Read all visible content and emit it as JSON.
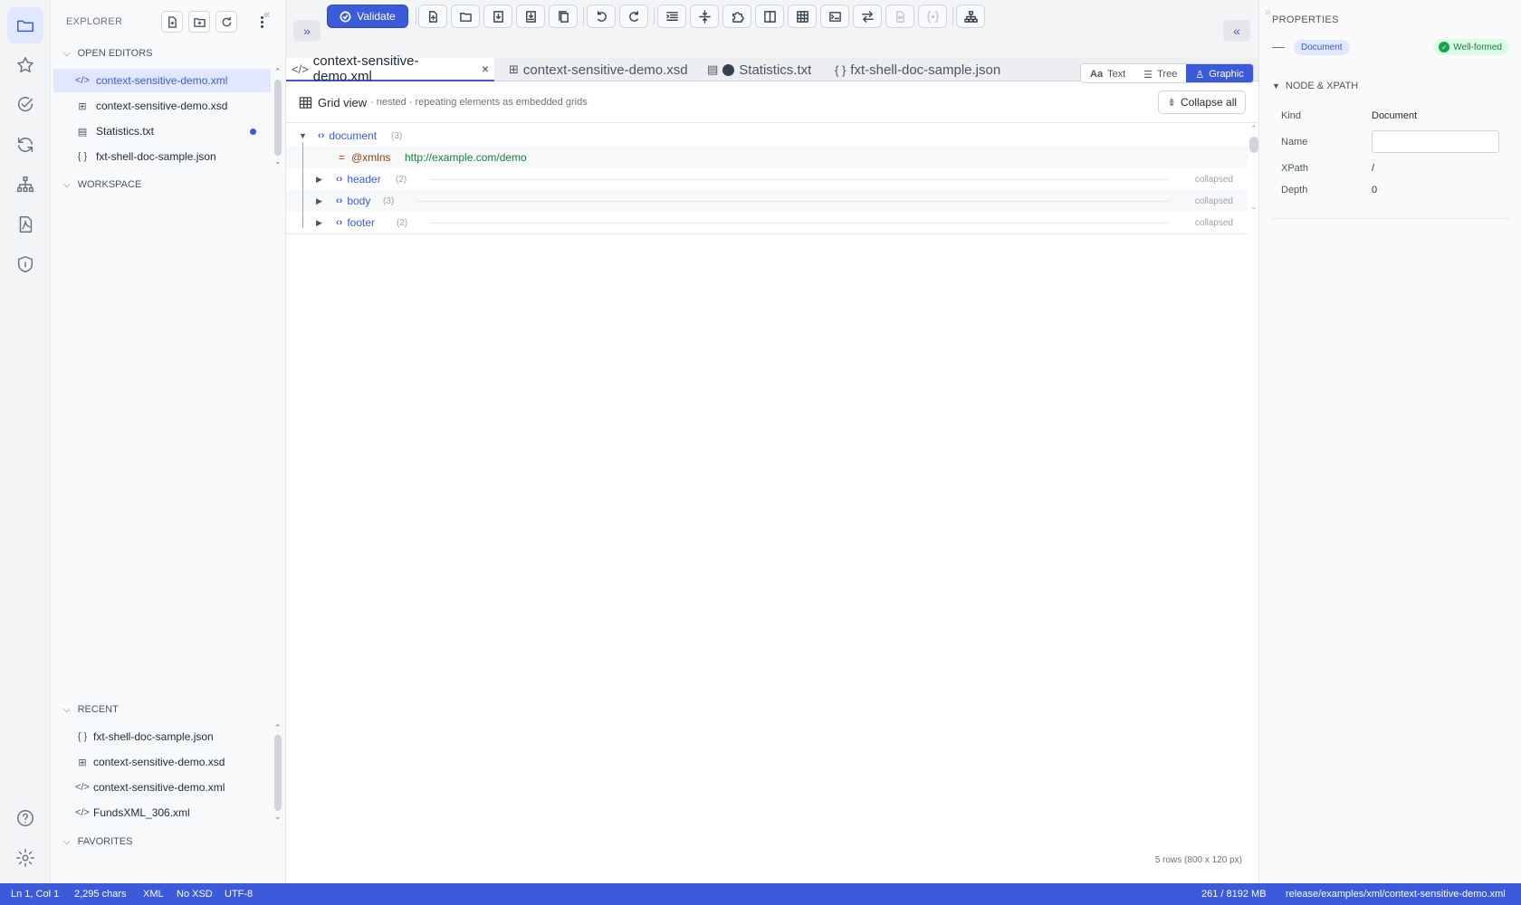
{
  "explorer": {
    "title": "EXPLORER",
    "open_editors": "OPEN EDITORS",
    "workspace": "WORKSPACE",
    "recent": "RECENT",
    "favorites": "FAVORITES",
    "open_files": [
      {
        "label": "context-sensitive-demo.xml",
        "icon": "xml-icon"
      },
      {
        "label": "context-sensitive-demo.xsd",
        "icon": "schema-icon"
      },
      {
        "label": "Statistics.txt",
        "icon": "text-file-icon"
      },
      {
        "label": "fxt-shell-doc-sample.json",
        "icon": "json-icon"
      }
    ],
    "recent_files": [
      {
        "label": "fxt-shell-doc-sample.json",
        "icon": "json-icon"
      },
      {
        "label": "context-sensitive-demo.xsd",
        "icon": "schema-icon"
      },
      {
        "label": "context-sensitive-demo.xml",
        "icon": "xml-icon"
      },
      {
        "label": "FundsXML_306.xml",
        "icon": "xml-icon"
      }
    ]
  },
  "toolbar": {
    "validate_label": "Validate"
  },
  "tabs": [
    {
      "label": "context-sensitive-demo.xml",
      "active": true
    },
    {
      "label": "context-sensitive-demo.xsd"
    },
    {
      "label": "Statistics.txt"
    },
    {
      "label": "fxt-shell-doc-sample.json"
    }
  ],
  "view_modes": {
    "text": "Text",
    "tree": "Tree",
    "graphic": "Graphic"
  },
  "grid_view": {
    "title": "Grid view",
    "subtitle": "· nested · repeating elements as embedded grids",
    "collapse_all": "Collapse all",
    "rows": {
      "document": {
        "name": "document",
        "count": "(3)"
      },
      "attr": {
        "eq": "=",
        "name": "@xmlns",
        "value": "http://example.com/demo"
      },
      "header": {
        "name": "header",
        "count": "(2)",
        "state": "collapsed"
      },
      "body": {
        "name": "body",
        "count": "(3)",
        "state": "collapsed"
      },
      "footer": {
        "name": "footer",
        "count": "(2)",
        "state": "collapsed"
      }
    },
    "footer_info": "5 rows (800 x 120 px)"
  },
  "properties": {
    "title": "PROPERTIES",
    "doc_chip": "Document",
    "status_chip": "Well-formed",
    "section": "NODE & XPATH",
    "kind_label": "Kind",
    "kind_value": "Document",
    "name_label": "Name",
    "name_value": "",
    "xpath_label": "XPath",
    "xpath_value": "/",
    "depth_label": "Depth",
    "depth_value": "0"
  },
  "status": {
    "position": "Ln 1, Col 1",
    "chars": "2,295 chars",
    "lang": "XML",
    "schema": "No XSD",
    "encoding": "UTF-8",
    "memory": "261 / 8192 MB",
    "path": "release/examples/xml/context-sensitive-demo.xml"
  },
  "colors": {
    "accent": "#3b5bdb",
    "success": "#15803d"
  }
}
